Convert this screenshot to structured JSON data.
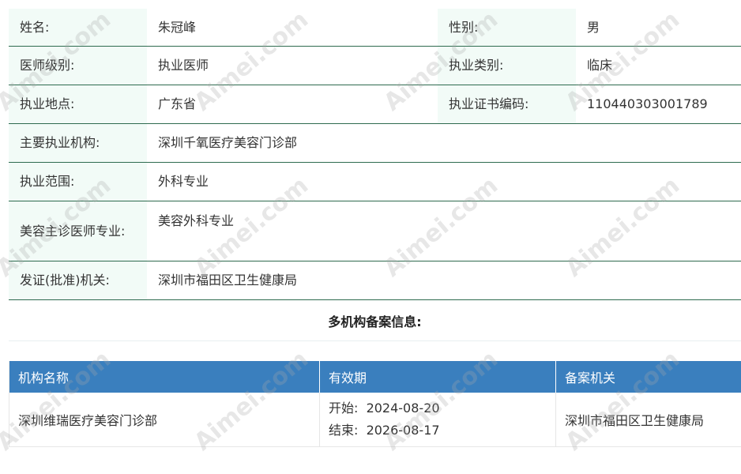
{
  "info": {
    "name_label": "姓名:",
    "name_value": "朱冠峰",
    "gender_label": "性别:",
    "gender_value": "男",
    "level_label": "医师级别:",
    "level_value": "执业医师",
    "category_label": "执业类别:",
    "category_value": "临床",
    "location_label": "执业地点:",
    "location_value": "广东省",
    "cert_label": "执业证书编码:",
    "cert_value": "110440303001789",
    "institution_label": "主要执业机构:",
    "institution_value": "深圳千氧医疗美容门诊部",
    "scope_label": "执业范围:",
    "scope_value": "外科专业",
    "cosmetic_label": "美容主诊医师专业:",
    "cosmetic_value": "美容外科专业",
    "issuer_label": "发证(批准)机关:",
    "issuer_value": "深圳市福田区卫生健康局"
  },
  "multi": {
    "title": "多机构备案信息:",
    "headers": [
      "机构名称",
      "有效期",
      "备案机关"
    ],
    "rows": [
      {
        "institution": "深圳维瑞医疗美容门诊部",
        "start": "开始:  2024-08-20",
        "end": "结束:  2026-08-17",
        "authority": "深圳市福田区卫生健康局"
      }
    ]
  },
  "watermark": "Aimei.com",
  "colors": {
    "label_bg": "#f2fbf7",
    "row_border": "#2e6b4f",
    "table_header_bg": "#3a7fbe"
  }
}
